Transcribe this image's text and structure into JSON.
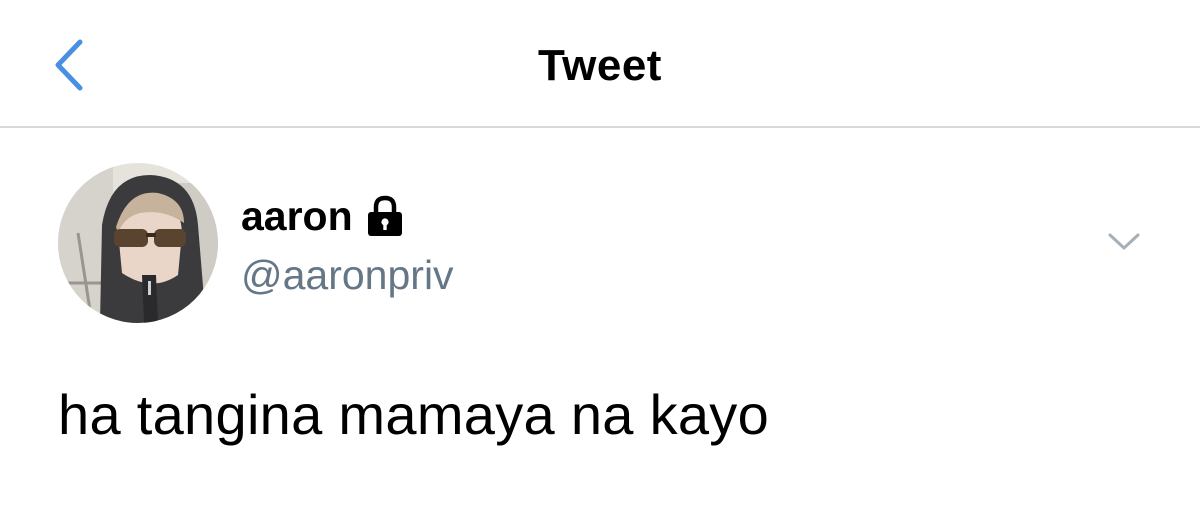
{
  "header": {
    "title": "Tweet",
    "back_icon": "chevron-left-icon",
    "accent_color": "#4a90e2"
  },
  "tweet": {
    "author": {
      "display_name": "aaron",
      "handle": "@aaronpriv",
      "protected_icon": "lock-icon",
      "avatar": "avatar-photo"
    },
    "menu_icon": "chevron-down-icon",
    "text": "ha tangina mamaya na kayo",
    "handle_color": "#657786"
  }
}
